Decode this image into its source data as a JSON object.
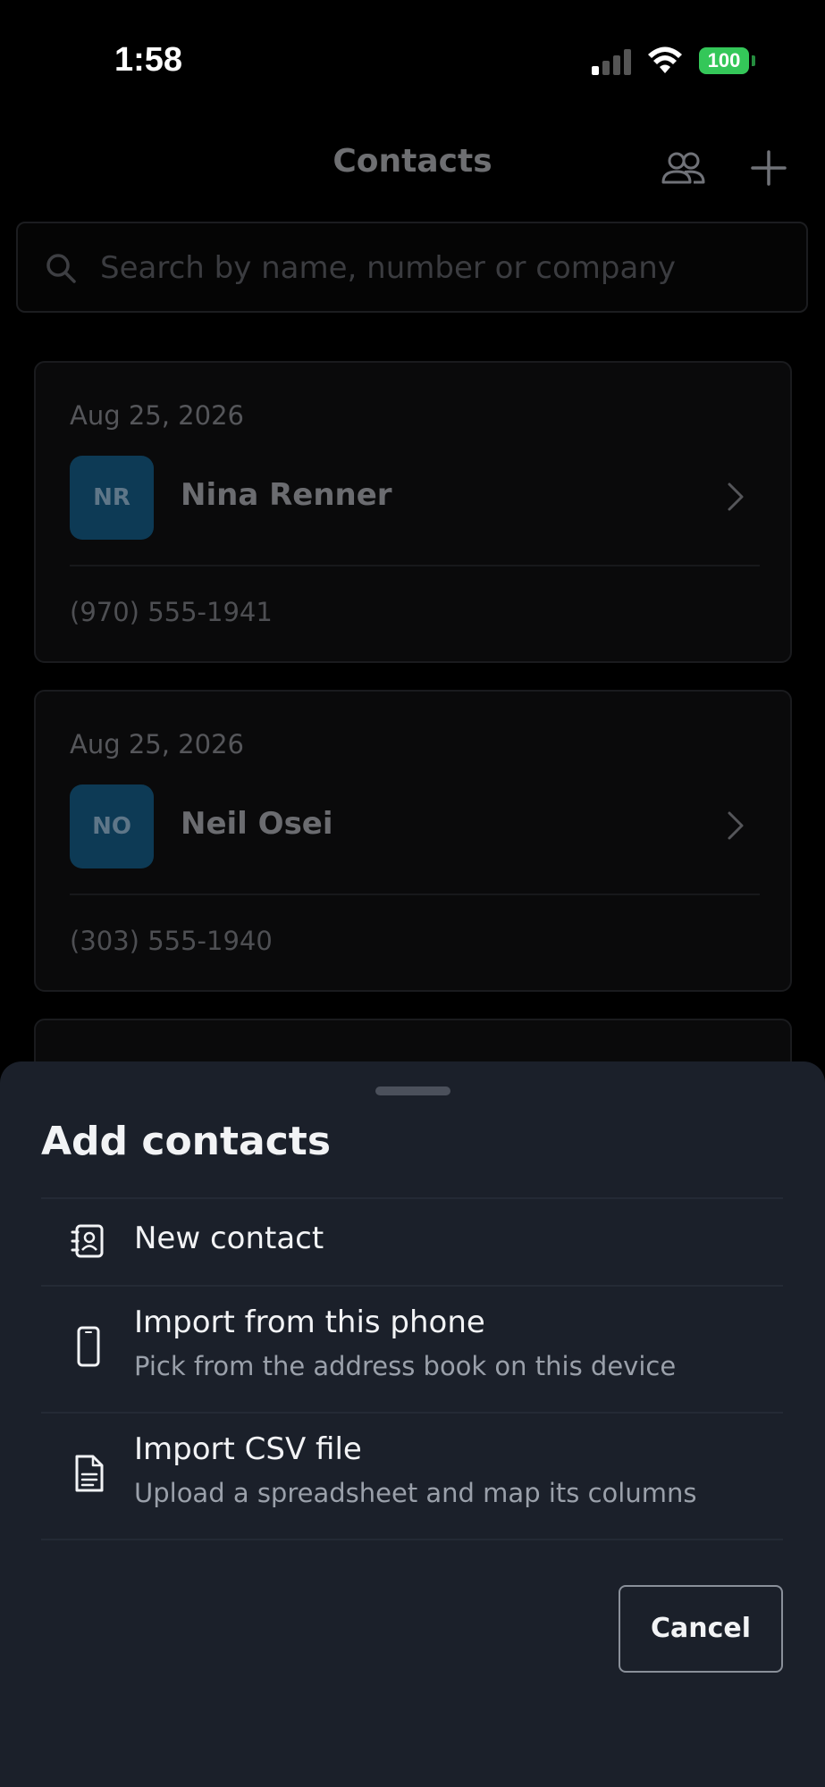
{
  "status_bar": {
    "time": "1:58",
    "battery": "100"
  },
  "header": {
    "title": "Contacts",
    "group_icon": "people-icon",
    "add_icon": "plus-icon"
  },
  "search": {
    "placeholder": "Search by name, number or company",
    "icon": "search-icon"
  },
  "contacts": [
    {
      "date": "Aug 25, 2026",
      "initials": "NR",
      "name": "Nina Renner",
      "phone": "(970) 555-1941"
    },
    {
      "date": "Aug 25, 2026",
      "initials": "NO",
      "name": "Neil Osei",
      "phone": "(303) 555-1940"
    }
  ],
  "sheet": {
    "title": "Add contacts",
    "options": [
      {
        "title": "New contact",
        "subtitle": "",
        "icon": "contact-card-icon"
      },
      {
        "title": "Import from this phone",
        "subtitle": "Pick from the address book on this device",
        "icon": "phone-icon"
      },
      {
        "title": "Import CSV file",
        "subtitle": "Upload a spreadsheet and map its columns",
        "icon": "document-icon"
      }
    ],
    "cancel_label": "Cancel"
  },
  "colors": {
    "sheet_background": "#1b202a",
    "avatar_background": "#0d3a55",
    "battery_green": "#34c759"
  }
}
